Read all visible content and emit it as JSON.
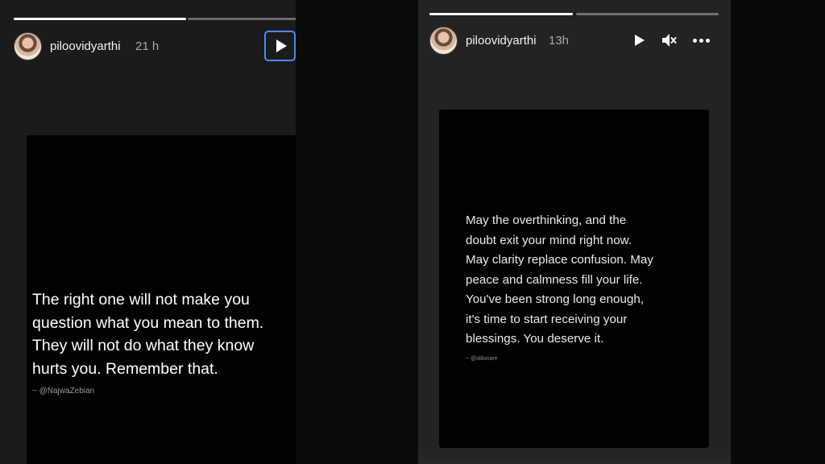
{
  "left_story": {
    "username": "piloovidyarthi",
    "time": "21 h",
    "progress": [
      1.0,
      0.0
    ],
    "quote": "The right one will not make you\nquestion what you mean to them.\nThey will not do what they know\nhurts you. Remember that.",
    "credit": "~ @NajwaZebian",
    "play_icon": "play-icon"
  },
  "right_story": {
    "username": "piloovidyarthi",
    "time": "13h",
    "progress": [
      1.0,
      0.0
    ],
    "quote": "May the overthinking, and the\ndoubt exit your mind right now.\nMay clarity replace confusion. May\npeace and calmness fill your life.\nYou've been strong long enough,\nit's time to start receiving your\nblessings. You deserve it.",
    "credit": "~ @idilonare",
    "icons": [
      "play-icon",
      "mute-icon",
      "more-icon"
    ]
  },
  "colors": {
    "story_bg_left": "#1b1b1b",
    "story_bg_right": "#232323",
    "focus_ring": "#4a89ff",
    "text_primary": "#ffffff",
    "text_secondary": "#a9a9a9"
  }
}
